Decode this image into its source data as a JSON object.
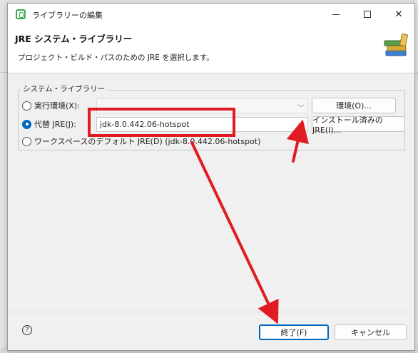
{
  "window": {
    "title": "ライブラリーの編集",
    "minimize": "最小化",
    "maximize": "最大化",
    "close": "✕"
  },
  "header": {
    "title": "JRE システム・ライブラリー",
    "description": "プロジェクト・ビルド・パスのための JRE を選択します。"
  },
  "group": {
    "label": "システム・ライブラリー",
    "options": [
      {
        "label": "実行環境(X):",
        "checked": false,
        "combo_value": "",
        "button": "環境(O)..."
      },
      {
        "label": "代替 JRE(J):",
        "checked": true,
        "combo_value": "jdk-8.0.442.06-hotspot",
        "button": "インストール済みの JRE(I)..."
      },
      {
        "label": "ワークスペースのデフォルト JRE(D) (jdk-8.0.442.06-hotspot)",
        "checked": false
      }
    ]
  },
  "footer": {
    "help": "?",
    "finish": "終了(F)",
    "cancel": "キャンセル"
  },
  "annotation_color": "#e11b22"
}
